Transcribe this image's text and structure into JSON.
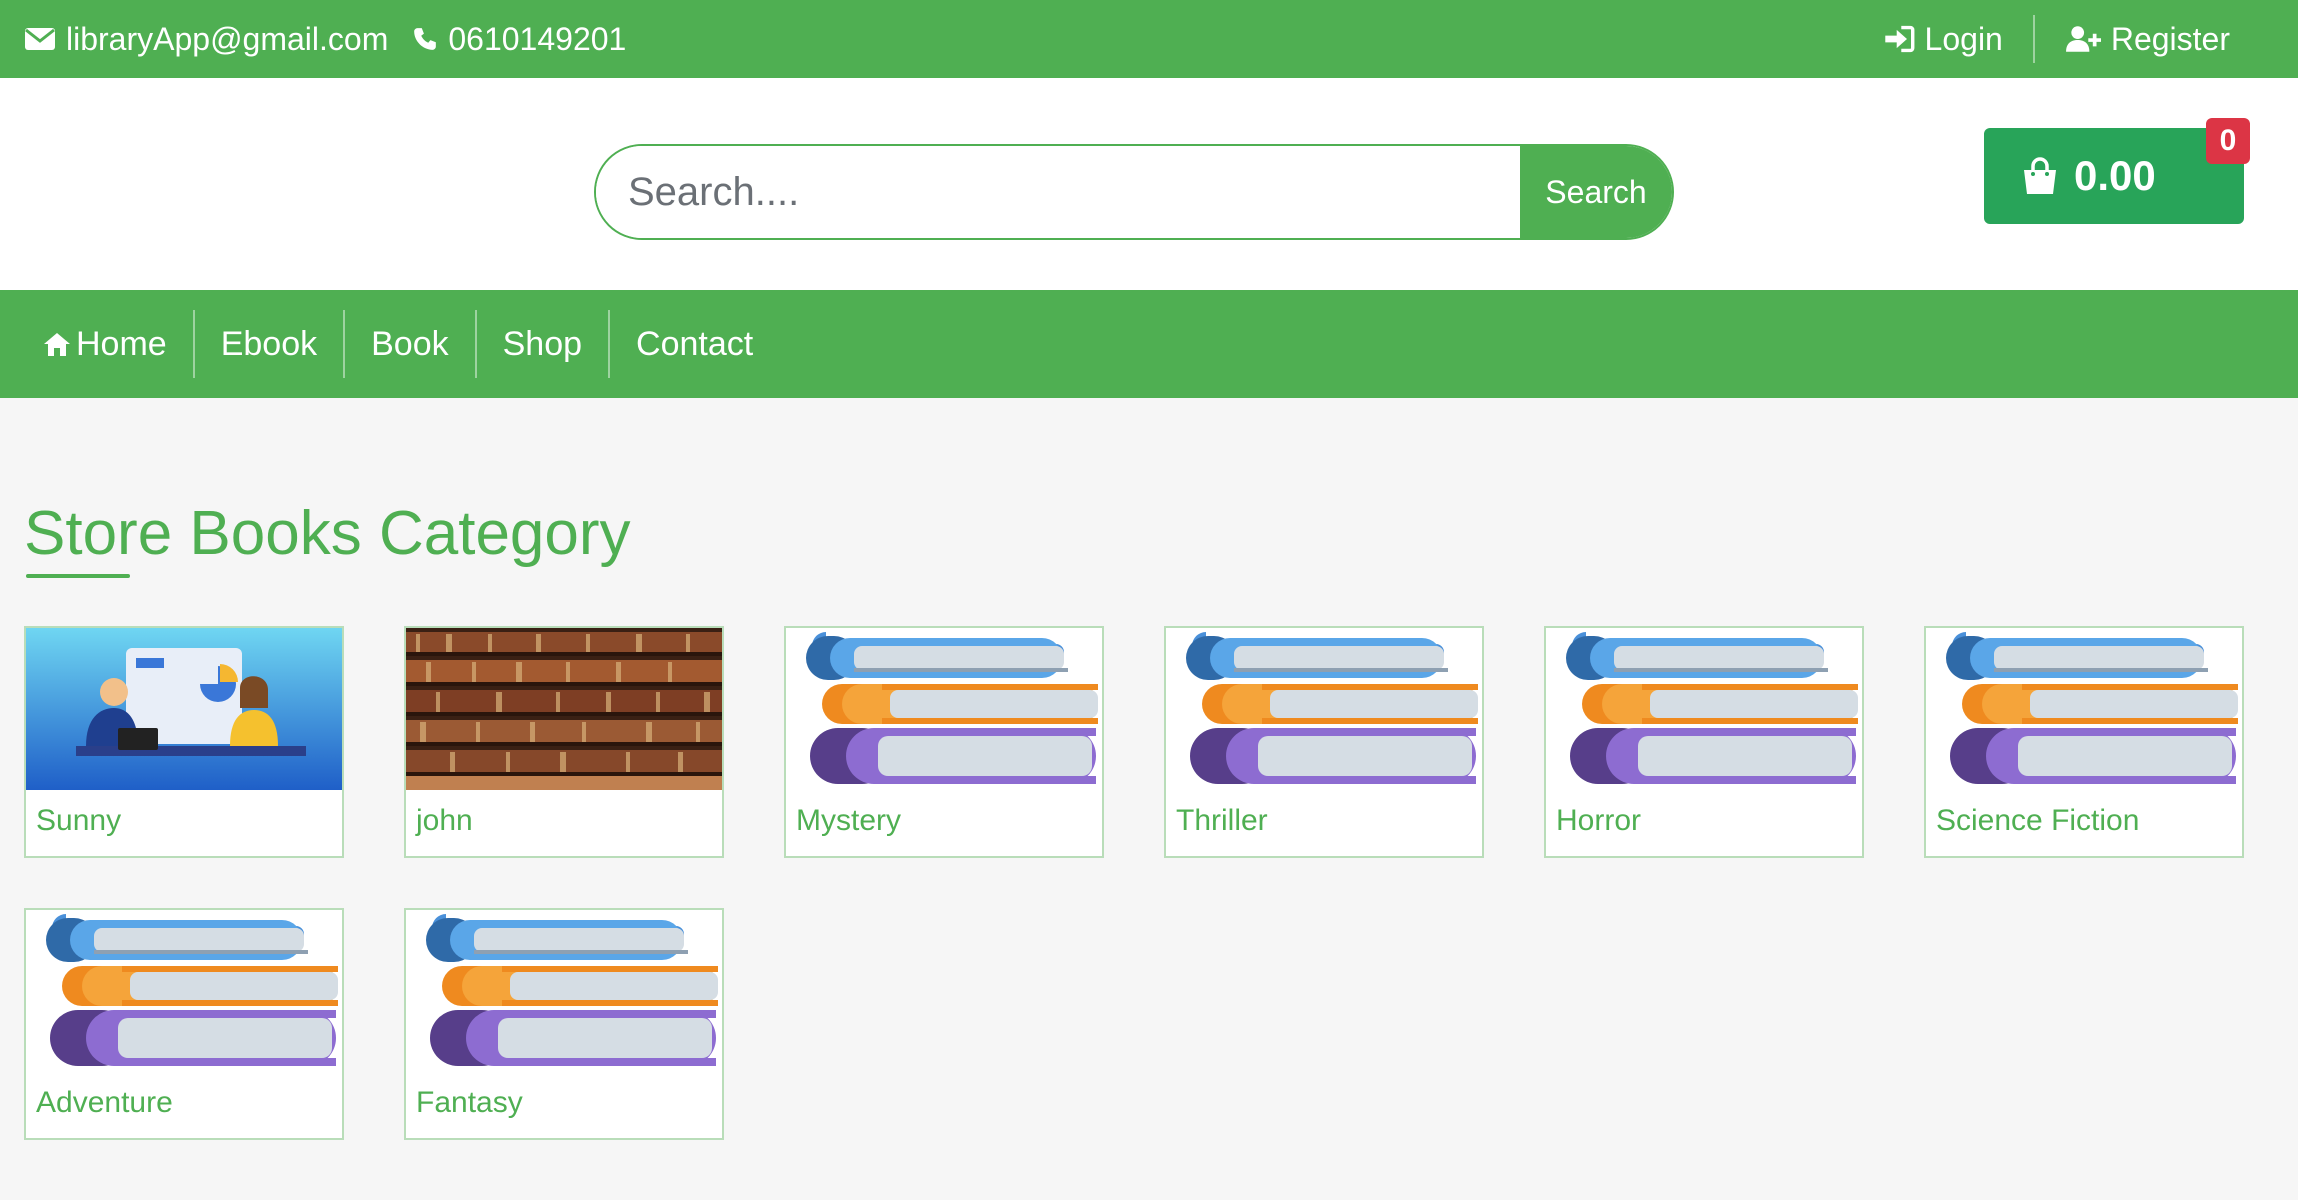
{
  "topbar": {
    "email": "libraryApp@gmail.com",
    "phone": "0610149201",
    "login": "Login",
    "register": "Register"
  },
  "search": {
    "placeholder": "Search....",
    "button": "Search"
  },
  "cart": {
    "total": "0.00",
    "count": "0"
  },
  "nav": {
    "home": "Home",
    "ebook": "Ebook",
    "book": "Book",
    "shop": "Shop",
    "contact": "Contact"
  },
  "main": {
    "title": "Store Books Category"
  },
  "categories": [
    {
      "label": "Sunny",
      "image": "team-illustration"
    },
    {
      "label": "john",
      "image": "bookshelf-photo"
    },
    {
      "label": "Mystery",
      "image": "book-stack"
    },
    {
      "label": "Thriller",
      "image": "book-stack"
    },
    {
      "label": "Horror",
      "image": "book-stack"
    },
    {
      "label": "Science Fiction",
      "image": "book-stack"
    },
    {
      "label": "Adventure",
      "image": "book-stack"
    },
    {
      "label": "Fantasy",
      "image": "book-stack"
    }
  ],
  "colors": {
    "brand_green": "#4faf52",
    "cart_badge": "#dc3545"
  }
}
